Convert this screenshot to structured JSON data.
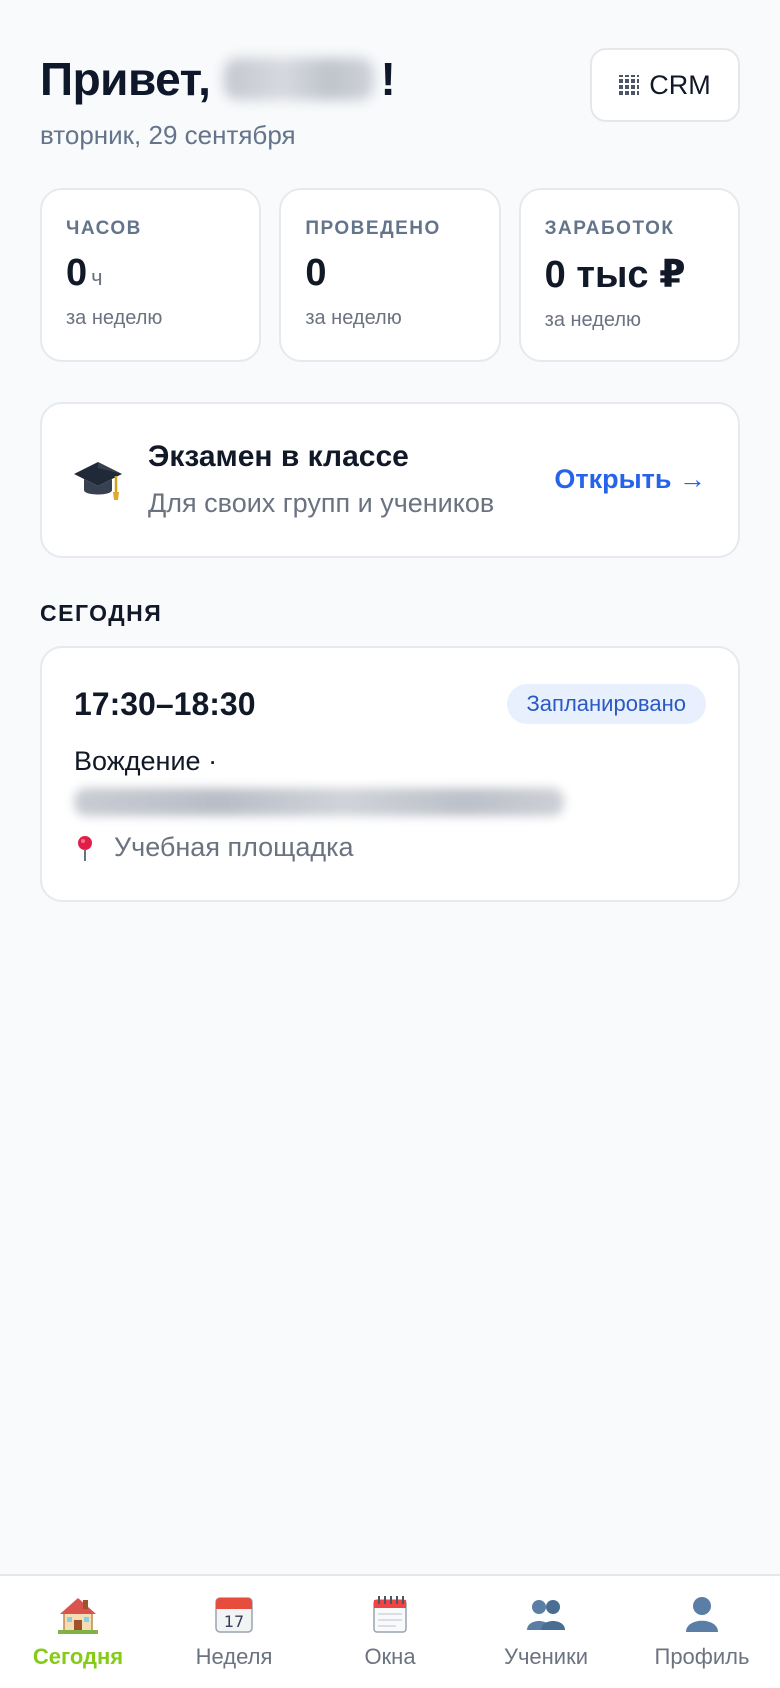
{
  "header": {
    "greeting_prefix": "Привет,",
    "greeting_suffix": "!",
    "date": "вторник, 29 сентября",
    "crm_label": "CRM"
  },
  "stats": [
    {
      "label": "ЧАСОВ",
      "value": "0",
      "unit": "ч",
      "sub": "за неделю"
    },
    {
      "label": "ПРОВЕДЕНО",
      "value": "0",
      "unit": "",
      "sub": "за неделю"
    },
    {
      "label": "ЗАРАБОТОК",
      "value": "0 тыс ₽",
      "unit": "",
      "sub": "за неделю"
    }
  ],
  "exam": {
    "title": "Экзамен в классе",
    "subtitle": "Для своих групп и учеников",
    "open_label": "Открыть →",
    "icon": "graduation-cap-icon"
  },
  "today": {
    "section_title": "СЕГОДНЯ",
    "lesson": {
      "time": "17:30–18:30",
      "status": "Запланировано",
      "type": "Вождение ·",
      "location": "Учебная площадка"
    }
  },
  "nav": [
    {
      "label": "Сегодня",
      "icon": "house-icon",
      "active": true
    },
    {
      "label": "Неделя",
      "icon": "calendar-icon",
      "active": false
    },
    {
      "label": "Окна",
      "icon": "spiral-calendar-icon",
      "active": false
    },
    {
      "label": "Ученики",
      "icon": "users-icon",
      "active": false
    },
    {
      "label": "Профиль",
      "icon": "profile-icon",
      "active": false
    }
  ],
  "colors": {
    "accent_blue": "#2563eb",
    "nav_active": "#84cc16",
    "badge_bg": "#e8f0fe"
  }
}
